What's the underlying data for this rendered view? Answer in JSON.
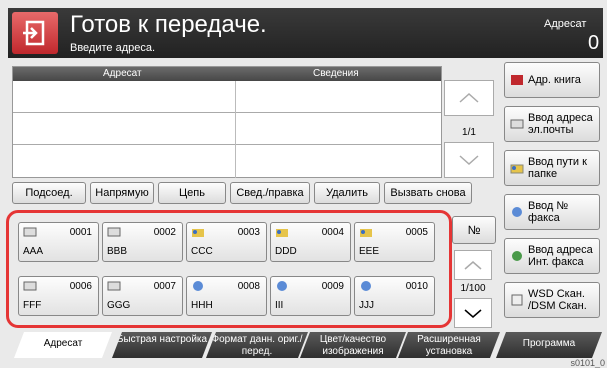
{
  "header": {
    "title": "Готов к передаче.",
    "subtitle": "Введите адреса.",
    "dest_label": "Адресат",
    "dest_count": "0"
  },
  "list": {
    "col_address": "Адресат",
    "col_info": "Сведения",
    "page": "1/1"
  },
  "right_buttons": [
    "Адр. книга",
    "Ввод адреса эл.почты",
    "Ввод пути к папке",
    "Ввод № факса",
    "Ввод адреса Инт. факса",
    "WSD Скан. /DSM Скан."
  ],
  "actions": [
    "Подсоед.",
    "Напрямую",
    "Цепь",
    "Свед./правка",
    "Удалить",
    "Вызвать снова"
  ],
  "keys": [
    {
      "num": "0001",
      "name": "AAA",
      "icon": "printer-icon"
    },
    {
      "num": "0002",
      "name": "BBB",
      "icon": "printer-icon"
    },
    {
      "num": "0003",
      "name": "CCC",
      "icon": "folder-icon"
    },
    {
      "num": "0004",
      "name": "DDD",
      "icon": "folder-icon"
    },
    {
      "num": "0005",
      "name": "EEE",
      "icon": "folder-icon"
    },
    {
      "num": "0006",
      "name": "FFF",
      "icon": "printer-icon"
    },
    {
      "num": "0007",
      "name": "GGG",
      "icon": "printer-icon"
    },
    {
      "num": "0008",
      "name": "HHH",
      "icon": "globe-icon"
    },
    {
      "num": "0009",
      "name": "III",
      "icon": "globe-icon"
    },
    {
      "num": "0010",
      "name": "JJJ",
      "icon": "globe-icon"
    }
  ],
  "grid": {
    "number_label": "№",
    "page": "1/100"
  },
  "tabs": [
    "Адресат",
    "Быстрая настройка",
    "Формат данн. ориг./перед.",
    "Цвет/качество изображения",
    "Расширенная установка",
    "Программа"
  ],
  "corner_code": "s0101_0",
  "colors": {
    "highlight": "#e53535",
    "header": "#2b2b2b",
    "send_icon": "#d23a3f"
  }
}
